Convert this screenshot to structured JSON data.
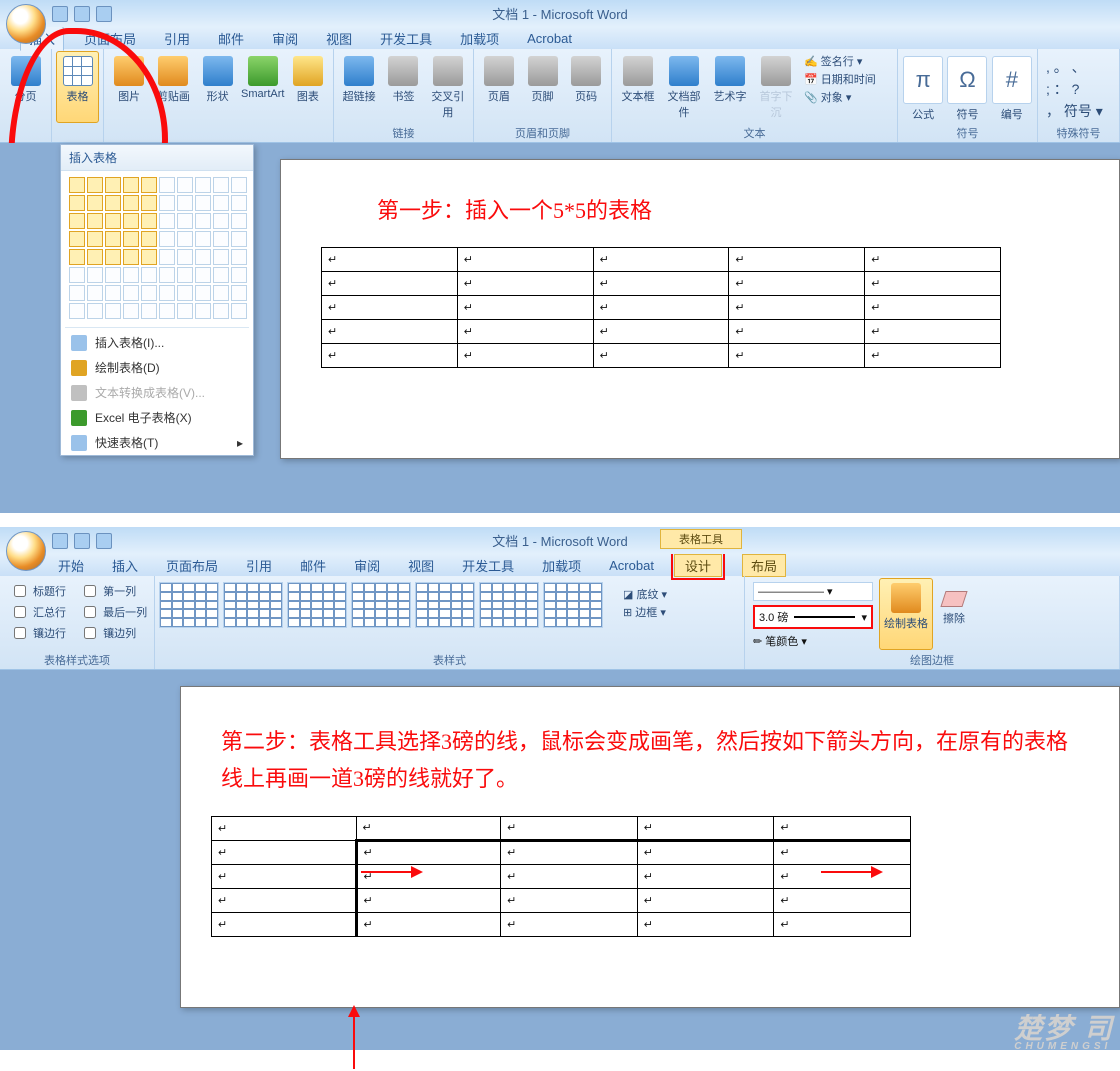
{
  "win1": {
    "title": "文档 1 - Microsoft Word",
    "tabs": [
      "插入",
      "页面布局",
      "引用",
      "邮件",
      "审阅",
      "视图",
      "开发工具",
      "加载项",
      "Acrobat"
    ],
    "active_tab": "插入",
    "groups": {
      "page": {
        "btn": "分页"
      },
      "table": {
        "btn": "表格",
        "dd_title": "插入表格",
        "items": [
          {
            "label": "插入表格(I)...",
            "enabled": true
          },
          {
            "label": "绘制表格(D)",
            "enabled": true
          },
          {
            "label": "文本转换成表格(V)...",
            "enabled": false
          },
          {
            "label": "Excel 电子表格(X)",
            "enabled": true
          },
          {
            "label": "快速表格(T)",
            "enabled": true,
            "submenu": true
          }
        ]
      },
      "illus": {
        "btns": [
          "图片",
          "剪贴画",
          "形状",
          "SmartArt",
          "图表"
        ]
      },
      "links": {
        "btns": [
          "超链接",
          "书签",
          "交叉引用"
        ],
        "label": "链接"
      },
      "hf": {
        "btns": [
          "页眉",
          "页脚",
          "页码"
        ],
        "label": "页眉和页脚"
      },
      "text": {
        "btns": [
          "文本框",
          "文档部件",
          "艺术字",
          "首字下沉"
        ],
        "mini": [
          "签名行",
          "日期和时间",
          "对象"
        ],
        "label": "文本"
      },
      "sym": {
        "btns": [
          "公式",
          "符号",
          "编号"
        ],
        "label": "符号",
        "glyphs": [
          "π",
          "Ω",
          "#"
        ]
      },
      "special": {
        "label": "特殊符号",
        "glyphs": [
          ",",
          "。",
          "、",
          ";",
          "：",
          "?",
          "，",
          "符号"
        ]
      }
    },
    "step": "第一步：插入一个5*5的表格",
    "table_cell_marker": "↵"
  },
  "win2": {
    "title": "文档 1 - Microsoft Word",
    "context_title": "表格工具",
    "tabs": [
      "开始",
      "插入",
      "页面布局",
      "引用",
      "邮件",
      "审阅",
      "视图",
      "开发工具",
      "加载项",
      "Acrobat"
    ],
    "ctx_tabs": [
      "设计",
      "布局"
    ],
    "active_tab": "设计",
    "groups": {
      "opts": {
        "label": "表格样式选项",
        "checks": [
          [
            "标题行",
            "第一列"
          ],
          [
            "汇总行",
            "最后一列"
          ],
          [
            "镶边行",
            "镶边列"
          ]
        ]
      },
      "styles": {
        "label": "表样式",
        "shade": "底纹",
        "border": "边框"
      },
      "draw": {
        "label": "绘图边框",
        "pt": "3.0 磅",
        "pen": "笔颜色",
        "draw_btn": "绘制表格",
        "erase": "擦除",
        "line_style": "——————"
      }
    },
    "step": "第二步：表格工具选择3磅的线，鼠标会变成画笔，然后按如下箭头方向，在原有的表格线上再画一道3磅的线就好了。",
    "table_cell_marker": "↵"
  },
  "watermark": {
    "big": "楚梦 司",
    "small": "CHUMENGSI"
  }
}
